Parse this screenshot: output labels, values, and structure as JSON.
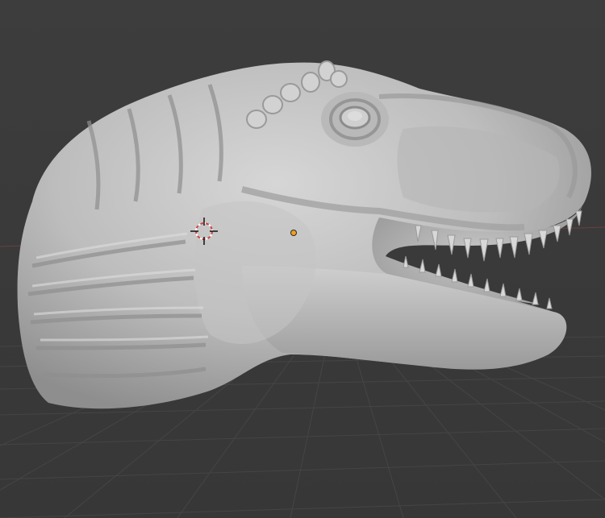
{
  "viewport": {
    "background_color": "#3a3a3a",
    "grid_color": "#454545",
    "model_color": "#c9c9c9",
    "cursor_color": "#d04545",
    "origin_color": "#f0a020"
  },
  "icons": {
    "cursor": "3d-cursor-icon",
    "origin": "object-origin-icon"
  }
}
